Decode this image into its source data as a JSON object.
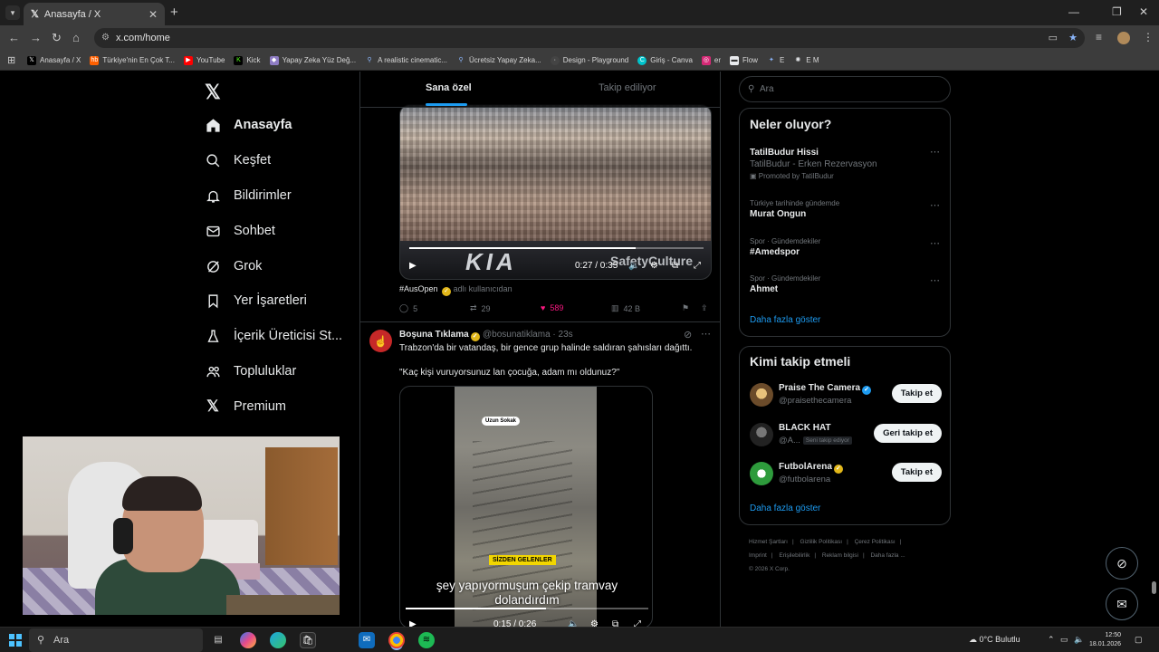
{
  "browser": {
    "tab_title": "Anasayfa / X",
    "url": "x.com/home",
    "bookmarks": [
      {
        "label": "Anasayfa / X",
        "icon": "x-icon",
        "color": "#ffffff"
      },
      {
        "label": "Türkiye'nin En Çok T...",
        "icon": "hb-icon",
        "color": "#ff6000"
      },
      {
        "label": "YouTube",
        "icon": "youtube-icon",
        "color": "#ff0000"
      },
      {
        "label": "Kick",
        "icon": "kick-icon",
        "color": "#53fc18"
      },
      {
        "label": "Yapay Zeka Yüz Değ...",
        "icon": "ai-icon",
        "color": "#8e7cc3"
      },
      {
        "label": "A realistic cinematic...",
        "icon": "search-icon",
        "color": "#8ab4f8"
      },
      {
        "label": "Ücretsiz Yapay Zeka...",
        "icon": "search-icon",
        "color": "#8ab4f8"
      },
      {
        "label": "Design - Playground",
        "icon": "playground-icon",
        "color": "#444444"
      },
      {
        "label": "Giriş - Canva",
        "icon": "canva-icon",
        "color": "#00c4cc"
      },
      {
        "label": "er",
        "icon": "instagram-icon",
        "color": "#d62976"
      },
      {
        "label": "Flow",
        "icon": "folder-icon",
        "color": "#e8eaed"
      },
      {
        "label": "E",
        "icon": "gemini-icon",
        "color": "#8ab4f8"
      },
      {
        "label": "E M",
        "icon": "chatgpt-icon",
        "color": "#e8eaed"
      }
    ]
  },
  "nav": {
    "items": [
      {
        "label": "Anasayfa",
        "icon": "home-icon",
        "active": true
      },
      {
        "label": "Keşfet",
        "icon": "search-icon"
      },
      {
        "label": "Bildirimler",
        "icon": "bell-icon"
      },
      {
        "label": "Sohbet",
        "icon": "mail-icon"
      },
      {
        "label": "Grok",
        "icon": "grok-icon"
      },
      {
        "label": "Yer İşaretleri",
        "icon": "bookmark-icon"
      },
      {
        "label": "İçerik Üreticisi St...",
        "icon": "studio-icon"
      },
      {
        "label": "Topluluklar",
        "icon": "people-icon"
      },
      {
        "label": "Premium",
        "icon": "x-icon"
      }
    ]
  },
  "feed": {
    "tabs": [
      "Sana özel",
      "Takip ediliyor"
    ],
    "tweet1": {
      "video_brand": "KIA",
      "video_overlay": "SafetyCulture",
      "video_time": "0:27 / 0:35",
      "hashtag": "#AusOpen",
      "via": "adlı kullanıcıdan",
      "replies": "5",
      "retweets": "29",
      "likes": "589",
      "views": "42 B",
      "progress": 0.77
    },
    "tweet2": {
      "name": "Boşuna Tıklama",
      "handle": "@bosunatiklama · 23s",
      "line1": "Trabzon'da bir vatandaş, bir gence grup halinde saldıran şahısları dağıttı.",
      "line2": "\"Kaç kişi vuruyorsunuz lan çocuğa, adam mı oldunuz?\"",
      "pin_label": "Uzun Sokak",
      "sticker": "SİZDEN GELENLER",
      "caption1": "şey yapıyormuşum çekip tramvay",
      "caption2": "dolandırdım",
      "video_time": "0:15 / 0:26",
      "progress": 0.58
    }
  },
  "sidebar": {
    "search_placeholder": "Ara",
    "trends_title": "Neler oluyor?",
    "trends": [
      {
        "meta": "",
        "title": "TatilBudur Hissi",
        "sub": "TatilBudur - Erken Rezervasyon",
        "promo": "Promoted by TatilBudur"
      },
      {
        "meta": "Türkiye tarihinde gündemde",
        "title": "Murat Ongun"
      },
      {
        "meta": "Spor · Gündemdekiler",
        "title": "#Amedspor"
      },
      {
        "meta": "Spor · Gündemdekiler",
        "title": "Ahmet"
      }
    ],
    "show_more": "Daha fazla göster",
    "who_title": "Kimi takip etmeli",
    "who": [
      {
        "name": "Praise The Camera",
        "handle": "@praisethecamera",
        "button": "Takip et",
        "badge": "blue"
      },
      {
        "name": "BLACK HAT",
        "handle": "@A...",
        "tag": "Seni takip ediyor",
        "button": "Geri takip et"
      },
      {
        "name": "FutbolArena",
        "handle": "@futbolarena",
        "button": "Takip et",
        "badge": "gold"
      }
    ],
    "footer_links": [
      "Hizmet Şartları",
      "Gizlilik Politikası",
      "Çerez Politikası",
      "Imprint",
      "Erişilebilirlik",
      "Reklam bilgisi",
      "Daha fazla ..."
    ],
    "copyright": "© 2026 X Corp."
  },
  "taskbar": {
    "search_placeholder": "Ara",
    "weather": "0°C  Bulutlu",
    "time": "12:50",
    "date": "18.01.2026"
  }
}
